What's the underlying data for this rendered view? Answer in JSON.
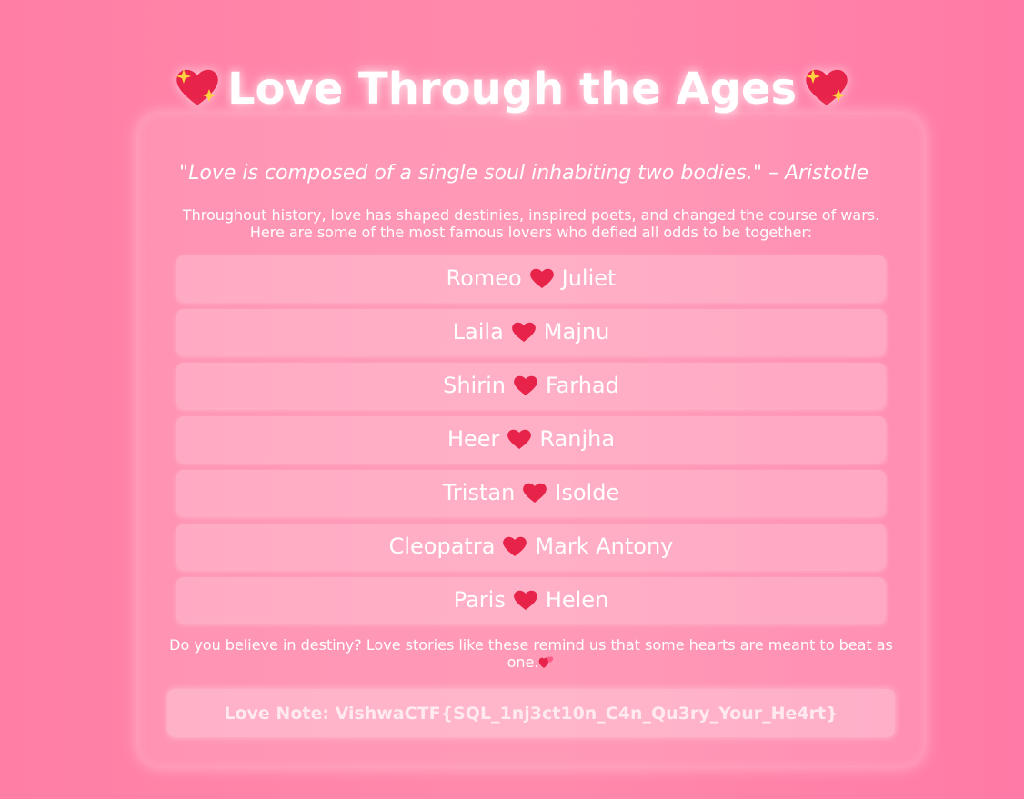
{
  "page": {
    "title": "Love Through the Ages",
    "title_icon": "sparkling-heart-icon",
    "quote": "\"Love is composed of a single soul inhabiting two bodies.\" – Aristotle",
    "intro_line1": "Throughout history, love has shaped destinies, inspired poets, and changed the course of wars.",
    "intro_line2": "Here are some of the most famous lovers who defied all odds to be together:",
    "lovers": [
      {
        "left": "Romeo",
        "right": "Juliet"
      },
      {
        "left": "Laila",
        "right": "Majnu"
      },
      {
        "left": "Shirin",
        "right": "Farhad"
      },
      {
        "left": "Heer",
        "right": "Ranjha"
      },
      {
        "left": "Tristan",
        "right": "Isolde"
      },
      {
        "left": "Cleopatra",
        "right": "Mark Antony"
      },
      {
        "left": "Paris",
        "right": "Helen"
      }
    ],
    "separator_icon": "red-heart-icon",
    "closing_line1": "Do you believe in destiny? Love stories like these remind us that some hearts are meant to beat as",
    "closing_line2": "one.",
    "closing_icon": "two-hearts-icon",
    "love_note": "Love Note: VishwaCTF{SQL_1nj3ct10n_C4n_Qu3ry_Your_He4rt}"
  },
  "colors": {
    "background": "#ff85aa",
    "heart": "#e8234a",
    "sparkle": "#ffd23f",
    "text": "#ffffff"
  }
}
